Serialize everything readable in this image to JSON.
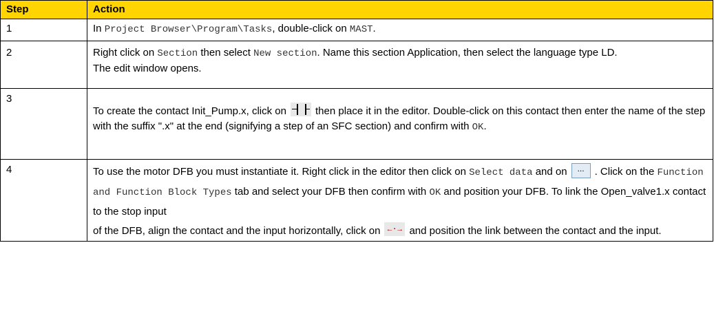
{
  "header": {
    "step": "Step",
    "action": "Action"
  },
  "rows": {
    "r1": {
      "step": "1",
      "a_pre": "In ",
      "a_code1": "Project Browser\\Program\\Tasks",
      "a_mid": ", double-click on ",
      "a_code2": "MAST",
      "a_end": "."
    },
    "r2": {
      "step": "2",
      "a_pre": "Right click on ",
      "a_code1": "Section",
      "a_mid": " then select ",
      "a_code2": "New section",
      "a_tail": ". Name this section Application, then select the language type LD.",
      "a_line2": "The edit window opens."
    },
    "r3": {
      "step": "3",
      "a_pre": "To create the contact Init_Pump.x, click on",
      "a_post": "then place it in the editor. Double-click on this contact then enter the name of the step with the suffix \".x\" at the end (signifying a step of an SFC section) and confirm with ",
      "a_code": "OK",
      "a_end": "."
    },
    "r4": {
      "step": "4",
      "a_pre": "To use the motor DFB you must instantiate it. Right click in the editor then click on ",
      "a_code1": "Select data",
      "a_and": "and on",
      "a_btn": "...",
      "a_click": ". Click on the ",
      "a_code2": "Function and Function Block Types",
      "a_tab": " tab and select your DFB then confirm with ",
      "a_code3": "OK",
      "a_pos": " and position your DFB. To link the Open_valve1.x contact to the stop input",
      "a_of": "of the DFB, align the contact and the input horizontally, click on",
      "a_link": "position the link between the contact and the input.",
      "a_link_pre": "and"
    }
  },
  "colors": {
    "header_bg": "#ffd400"
  },
  "icons": {
    "contact": "ld-contact-icon",
    "browse": "ellipsis-button-icon",
    "link": "ld-link-icon"
  }
}
